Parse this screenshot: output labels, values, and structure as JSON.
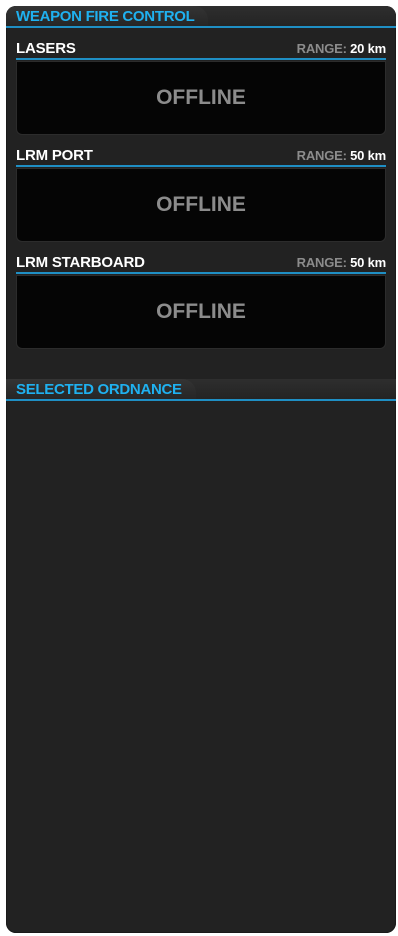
{
  "weapon_fire_control": {
    "title": "WEAPON FIRE CONTROL",
    "weapons": [
      {
        "name": "LASERS",
        "range_label": "RANGE:",
        "range_value": "20 km",
        "status": "OFFLINE"
      },
      {
        "name": "LRM PORT",
        "range_label": "RANGE:",
        "range_value": "50 km",
        "status": "OFFLINE"
      },
      {
        "name": "LRM STARBOARD",
        "range_label": "RANGE:",
        "range_value": "50 km",
        "status": "OFFLINE"
      }
    ]
  },
  "selected_ordnance": {
    "title": "SELECTED ORDNANCE"
  },
  "colors": {
    "accent": "#1fb1f0",
    "panel_background": "#222222",
    "status_box_background": "#050505",
    "offline_text": "#8c8c8c"
  }
}
